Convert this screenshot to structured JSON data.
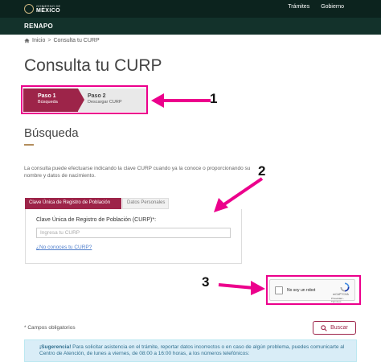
{
  "header": {
    "gov_line1": "GOBIERNO DE",
    "gov_line2": "MÉXICO",
    "nav": [
      "Trámites",
      "Gobierno"
    ]
  },
  "subbar": {
    "brand": "RENAPO"
  },
  "breadcrumb": {
    "home": "Inicio",
    "separator": ">",
    "current": "Consulta tu CURP"
  },
  "page_title": "Consulta tu CURP",
  "steps": [
    {
      "title": "Paso 1",
      "subtitle": "Búsqueda"
    },
    {
      "title": "Paso 2",
      "subtitle": "Descargar CURP"
    }
  ],
  "section_title": "Búsqueda",
  "intro_text": "La consulta puede efectuarse indicando la clave CURP cuando ya la conoce o proporcionando su nombre y datos de nacimiento.",
  "tabs": [
    {
      "label": "Clave Única de Registro de Población"
    },
    {
      "label": "Datos Personales"
    }
  ],
  "form": {
    "curp_label": "Clave Única de Registro de Población (CURP)*:",
    "curp_placeholder": "Ingresa tu CURP",
    "curp_value": "",
    "help_link": "¿No conoces tu CURP?"
  },
  "recaptcha": {
    "label": "No soy un robot",
    "brand": "reCAPTCHA",
    "terms": "Privacidad - Términos"
  },
  "required_note": "* Campos obligatorios",
  "search_button": "Buscar",
  "alert": {
    "strong": "¡Sugerencia!",
    "text": " Para solicitar asistencia en el trámite, reportar datos incorrectos o en caso de algún problema, puedes comunicarte al Centro de Atención, de lunes a viernes, de 08:00 a 16:00 horas, a los números telefónicos:"
  },
  "annotations": [
    "1",
    "2",
    "3"
  ],
  "colors": {
    "top_bar": "#0c231e",
    "sub_bar": "#13322b",
    "brand": "#9d2449",
    "accent_gold": "#b38e5d",
    "highlight": "#ec008c"
  }
}
